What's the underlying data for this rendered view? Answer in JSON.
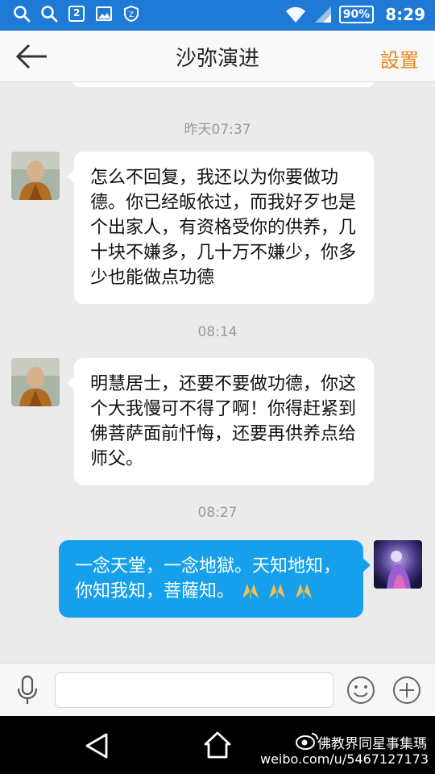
{
  "status_bar": {
    "battery": "90%",
    "time": "8:29",
    "left_icons": [
      "search-icon",
      "search-icon",
      "notification-2-icon",
      "image-icon",
      "shield-icon"
    ],
    "right_icons": [
      "wifi-icon",
      "signal-icon"
    ],
    "notification_count": "2"
  },
  "header": {
    "title": "沙弥演进",
    "settings_label": "設置",
    "back_icon": "back-arrow-icon"
  },
  "messages": [
    {
      "type": "timestamp",
      "text": "昨天07:37"
    },
    {
      "type": "incoming",
      "sender_avatar": "monk-avatar",
      "text": "怎么不回复，我还以为你要做功德。你已经皈依过，而我好歹也是个出家人，有资格受你的供养，几十块不嫌多，几十万不嫌少，你多少也能做点功德"
    },
    {
      "type": "timestamp",
      "text": "08:14"
    },
    {
      "type": "incoming",
      "sender_avatar": "monk-avatar",
      "text": "明慧居士，还要不要做功德，你这个大我慢可不得了啊！你得赶紧到佛菩萨面前忏悔，还要再供养点给师父。"
    },
    {
      "type": "timestamp",
      "text": "08:27"
    },
    {
      "type": "outgoing",
      "sender_avatar": "user-avatar",
      "text": "一念天堂，一念地獄。天知地知，你知我知，菩薩知。",
      "emojis": [
        "praying-hands-icon",
        "praying-hands-icon",
        "praying-hands-icon"
      ]
    }
  ],
  "input_bar": {
    "value": "",
    "mic_icon": "microphone-icon",
    "emoji_icon": "smiley-icon",
    "plus_icon": "plus-icon"
  },
  "nav_bar": {
    "back_icon": "nav-back-icon",
    "home_icon": "nav-home-icon",
    "watermark_brand": "佛教界同星事集瑪",
    "watermark_url": "weibo.com/u/5467127173"
  },
  "colors": {
    "status_bar": "#1f7ad6",
    "accent_settings": "#e5881d",
    "outgoing_bubble": "#16a0ec",
    "incoming_bubble": "#ffffff",
    "chat_background": "#ebebeb"
  }
}
